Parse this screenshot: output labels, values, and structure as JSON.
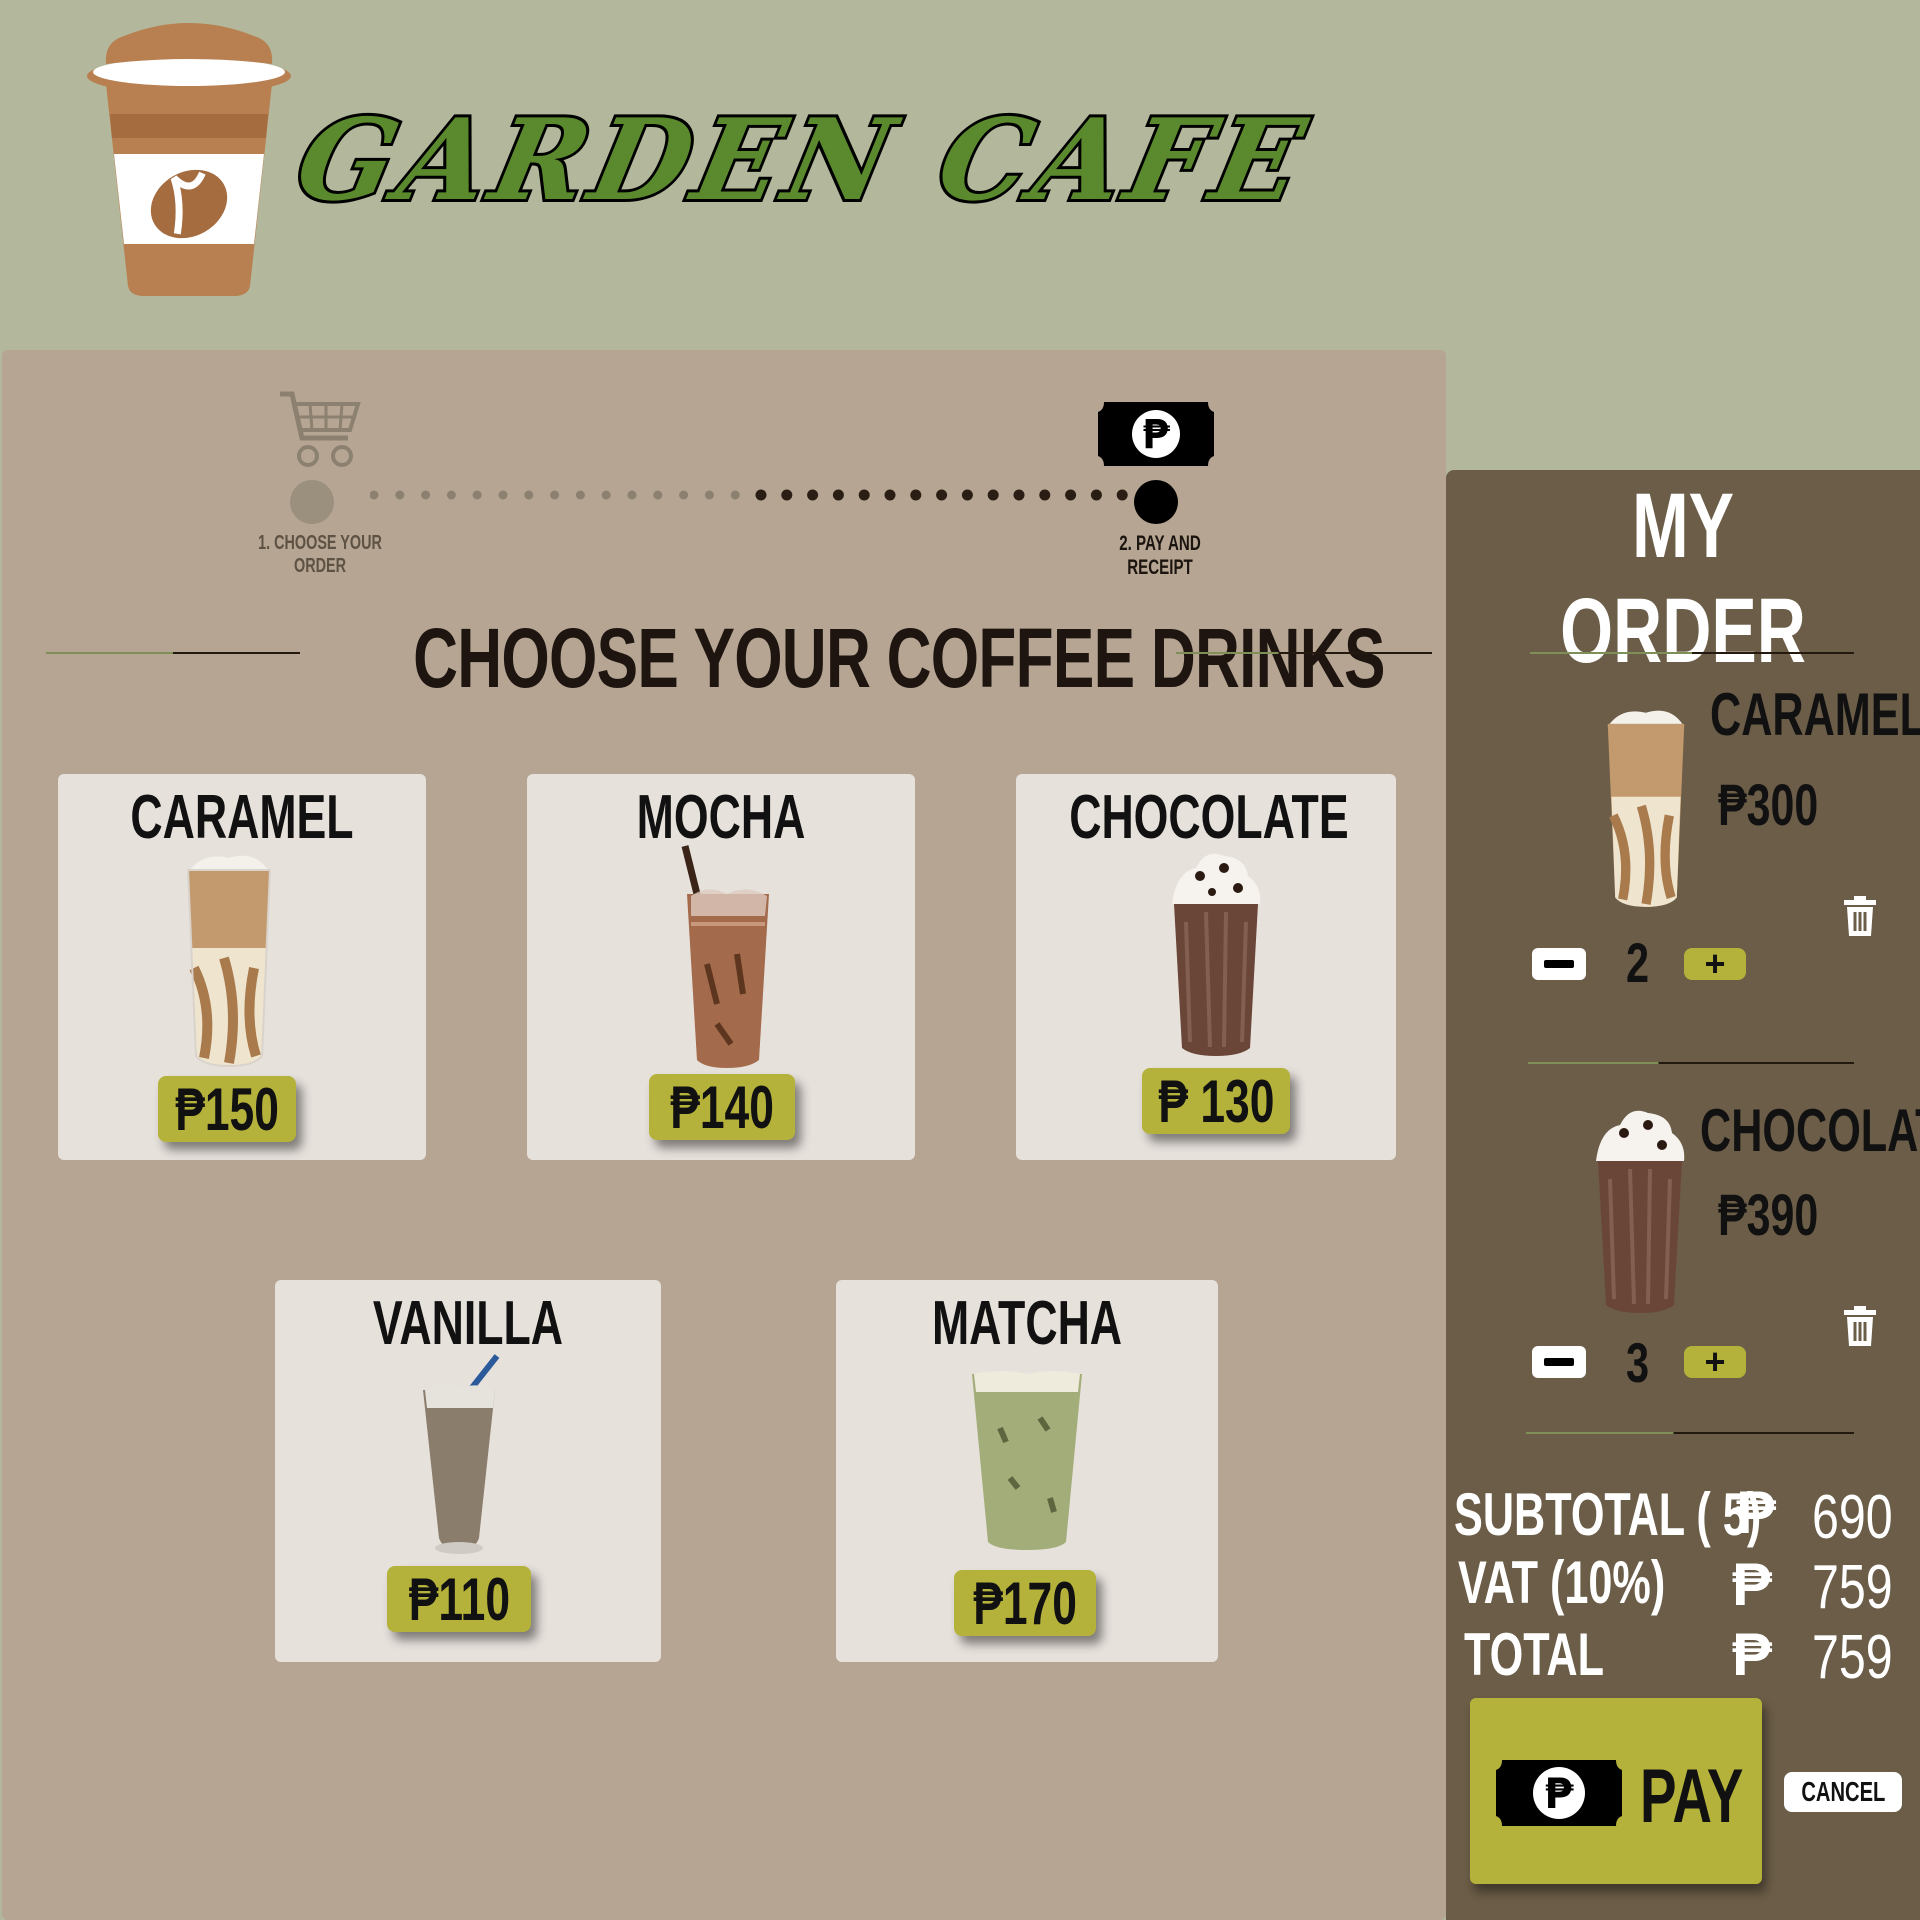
{
  "brand": {
    "name": "GARDEN CAFE"
  },
  "colors": {
    "background": "#b3b89c",
    "panel": "#b5a592",
    "card": "#e7e1dc",
    "accent": "#b5b23b",
    "order_panel": "#6b5d47",
    "brand_green": "#5b8a2e"
  },
  "steps": [
    {
      "label": "1. CHOOSE YOUR ORDER",
      "icon": "cart-icon",
      "state": "done"
    },
    {
      "label": "2. PAY AND RECEIPT",
      "icon": "peso-bill-icon",
      "state": "current"
    }
  ],
  "menu": {
    "title": "CHOOSE YOUR COFFEE DRINKS",
    "products": [
      {
        "name": "CARAMEL",
        "price": "₱150",
        "drink": "caramel-drink-image"
      },
      {
        "name": "MOCHA",
        "price": "₱140",
        "drink": "mocha-drink-image"
      },
      {
        "name": "CHOCOLATE",
        "price": "₱ 130",
        "drink": "chocolate-drink-image"
      },
      {
        "name": "VANILLA",
        "price": "₱110",
        "drink": "vanilla-drink-image"
      },
      {
        "name": "MATCHA",
        "price": "₱170",
        "drink": "matcha-drink-image"
      }
    ]
  },
  "order": {
    "title": "MY ORDER",
    "items": [
      {
        "name": "CARAMEL",
        "price": "₱300",
        "qty": "2"
      },
      {
        "name": "CHOCOLATE",
        "price": "₱390",
        "qty": "3"
      }
    ],
    "minus_symbol": "−",
    "plus_symbol": "+",
    "summary": [
      {
        "label": "SUBTOTAL ( 5)",
        "currency": "₱",
        "value": "690"
      },
      {
        "label": "VAT (10%)",
        "currency": "₱",
        "value": "759"
      },
      {
        "label": "TOTAL",
        "currency": "₱",
        "value": "759"
      }
    ],
    "pay_label": "PAY",
    "cancel_label": "CANCEL"
  }
}
